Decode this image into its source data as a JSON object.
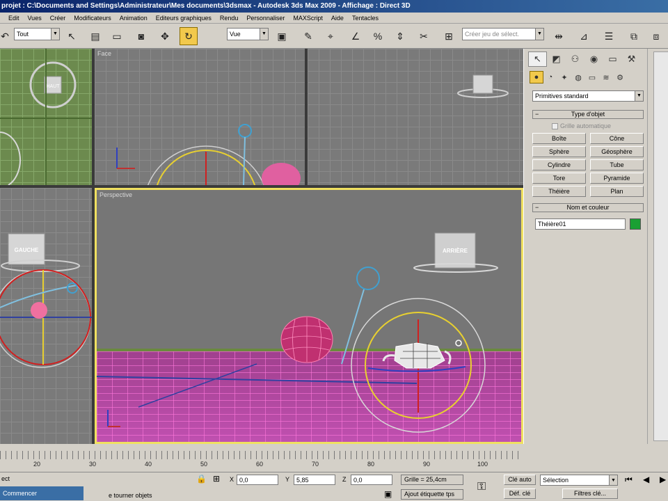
{
  "window": {
    "title": "projet : C:\\Documents and Settings\\Administrateur\\Mes documents\\3dsmax     - Autodesk 3ds Max 2009     - Affichage : Direct 3D"
  },
  "menu": [
    "Edit",
    "Vues",
    "Créer",
    "Modificateurs",
    "Animation",
    "Editeurs graphiques",
    "Rendu",
    "Personnaliser",
    "MAXScript",
    "Aide",
    "Tentacles"
  ],
  "toolbar": {
    "selection_filter": "Tout",
    "reference_coord": "Vue",
    "named_selection_placeholder": "Créer jeu de sélect."
  },
  "viewports": {
    "face_label": "Face",
    "perspective_label": "Perspective",
    "cube_top": "HAUT",
    "cube_left": "GAUCHE",
    "cube_back": "ARRIÈRE"
  },
  "command_panel": {
    "category": "Primitives standard",
    "object_type_title": "Type d'objet",
    "autogrid_label": "Grille automatique",
    "object_buttons": [
      "Boîte",
      "Cône",
      "Sphère",
      "Géosphère",
      "Cylindre",
      "Tube",
      "Tore",
      "Pyramide",
      "Théière",
      "Plan"
    ],
    "name_color_title": "Nom et couleur",
    "object_name": "Théière01",
    "object_color": "#1aa033"
  },
  "timeline": {
    "ticks": [
      "20",
      "30",
      "40",
      "50",
      "60",
      "70",
      "80",
      "90",
      "100"
    ]
  },
  "status": {
    "selection_text": "ect",
    "prompt_text": "e tourner objets",
    "taskbar_label": "Commencer",
    "x_label": "X",
    "x_value": "0,0",
    "y_label": "Y",
    "y_value": "5,85",
    "z_label": "Z",
    "z_value": "0,0",
    "grid_text": "Grille = 25,4cm",
    "add_time_tag": "Ajout étiquette tps",
    "auto_key": "Clé auto",
    "selection_set": "Sélection",
    "set_key": "Déf. clé",
    "key_filters": "Filtres clé..."
  }
}
